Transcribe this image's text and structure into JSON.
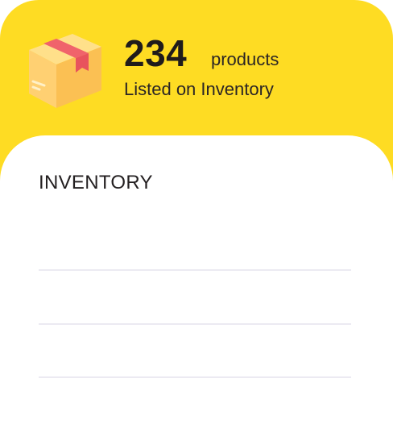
{
  "summary": {
    "count": "234",
    "unit": "products",
    "subtitle": "Listed on Inventory",
    "icon": "package-box-icon"
  },
  "section": {
    "title": "INVENTORY"
  },
  "inventory_rows": [
    "",
    "",
    ""
  ],
  "colors": {
    "header_background": "#FEDC23",
    "box_body": "#FFC85E",
    "box_tape": "#F0636B",
    "divider": "#ECEAF2"
  }
}
